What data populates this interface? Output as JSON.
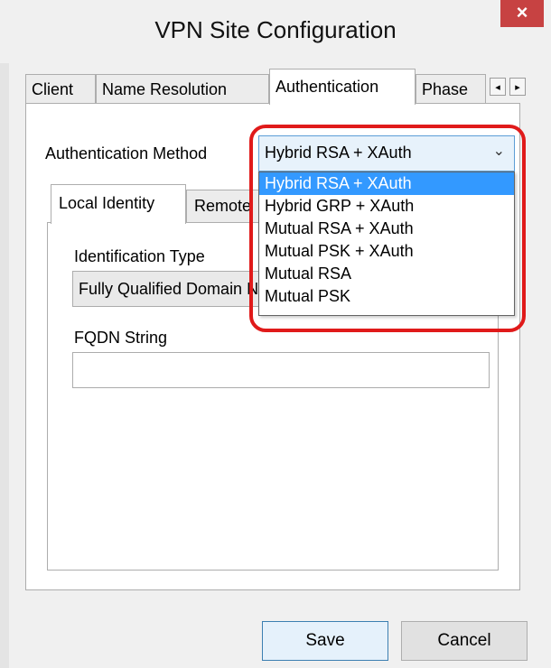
{
  "window": {
    "title": "VPN Site Configuration",
    "close_glyph": "×"
  },
  "tabs": [
    {
      "label": "Client"
    },
    {
      "label": "Name Resolution"
    },
    {
      "label": "Authentication",
      "active": true
    },
    {
      "label": "Phase"
    }
  ],
  "tab_scroll": {
    "left": "◂",
    "right": "▸"
  },
  "auth": {
    "method_label": "Authentication Method",
    "selected": "Hybrid RSA + XAuth",
    "options": [
      "Hybrid RSA + XAuth",
      "Hybrid GRP + XAuth",
      "Mutual RSA + XAuth",
      "Mutual PSK + XAuth",
      "Mutual RSA",
      "Mutual PSK"
    ]
  },
  "identity_tabs": [
    {
      "label": "Local Identity",
      "active": true
    },
    {
      "label": "Remote"
    }
  ],
  "identity": {
    "type_label": "Identification Type",
    "type_value": "Fully Qualified Domain Name",
    "fqdn_label": "FQDN String",
    "fqdn_value": ""
  },
  "buttons": {
    "save": "Save",
    "cancel": "Cancel"
  },
  "colors": {
    "highlight": "#e01a1a",
    "selection": "#3399ff",
    "close": "#c74242"
  }
}
